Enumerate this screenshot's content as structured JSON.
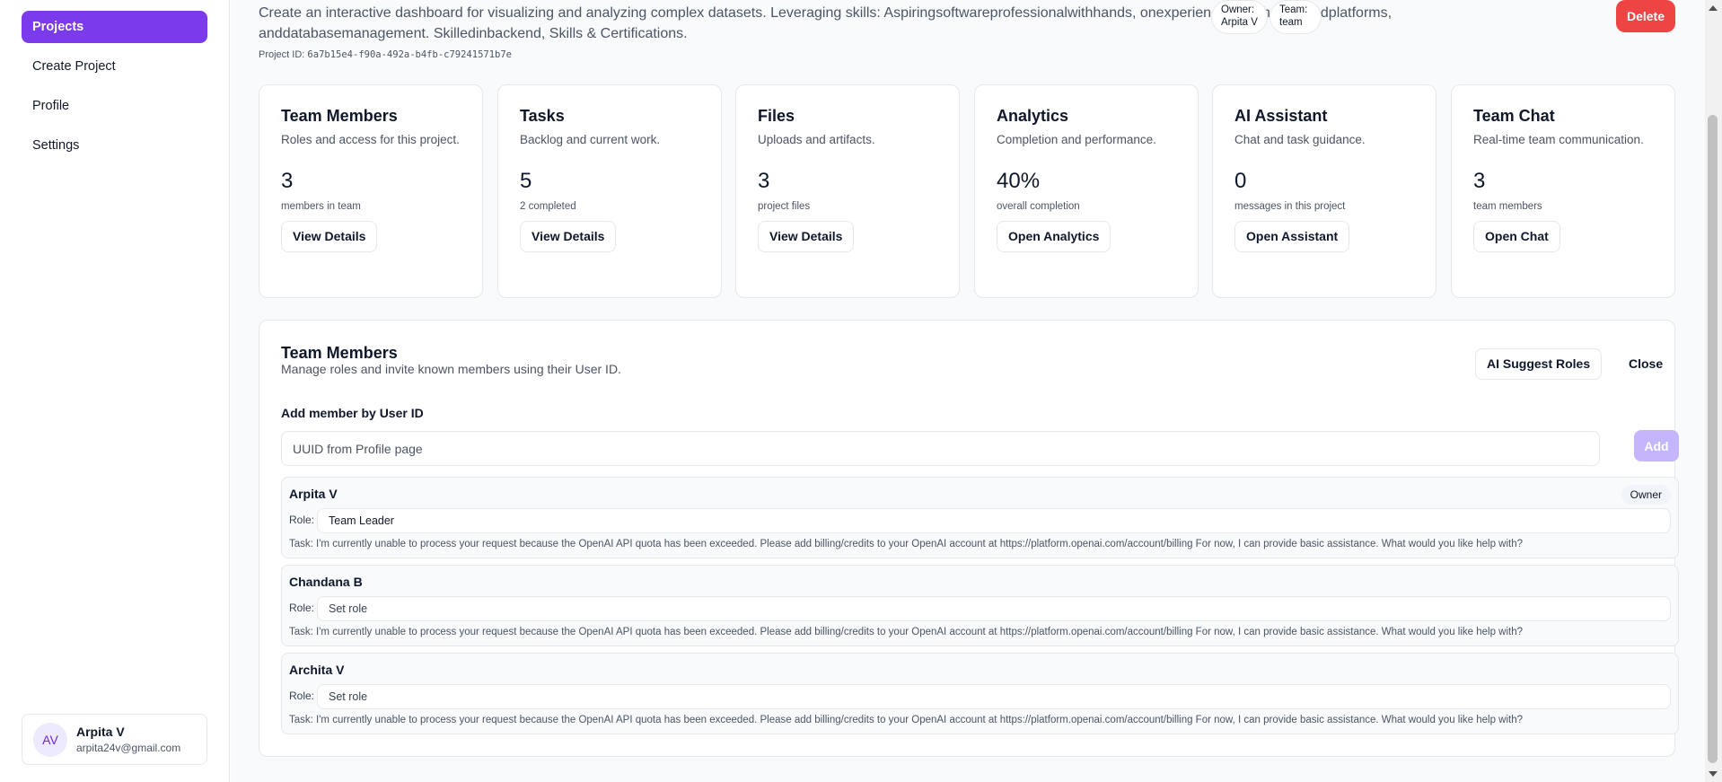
{
  "sidebar": {
    "nav": [
      {
        "label": "Projects",
        "active": true
      },
      {
        "label": "Create Project",
        "active": false
      },
      {
        "label": "Profile",
        "active": false
      },
      {
        "label": "Settings",
        "active": false
      }
    ],
    "user": {
      "initials": "AV",
      "name": "Arpita V",
      "email": "arpita24v@gmail.com"
    }
  },
  "header": {
    "description": "Create an interactive dashboard for visualizing and analyzing complex datasets. Leveraging skills: Aspiringsoftwareprofessionalwithhands, onexperiencein Python, cloudplatforms, anddatabasemanagement. Skilledinbackend, Skills & Certifications.",
    "project_id_label": "Project ID:",
    "project_id": "6a7b15e4-f90a-492a-b4fb-c79241571b7e",
    "owner_chip": {
      "line1": "Owner:",
      "line2": "Arpita V"
    },
    "team_chip": {
      "line1": "Team:",
      "line2": "team"
    },
    "delete_label": "Delete"
  },
  "cards": [
    {
      "title": "Team Members",
      "subtitle": "Roles and access for this project.",
      "value": "3",
      "caption": "members in team",
      "button": "View Details"
    },
    {
      "title": "Tasks",
      "subtitle": "Backlog and current work.",
      "value": "5",
      "caption": "2 completed",
      "button": "View Details"
    },
    {
      "title": "Files",
      "subtitle": "Uploads and artifacts.",
      "value": "3",
      "caption": "project files",
      "button": "View Details"
    },
    {
      "title": "Analytics",
      "subtitle": "Completion and performance.",
      "value": "40%",
      "caption": "overall completion",
      "button": "Open Analytics"
    },
    {
      "title": "AI Assistant",
      "subtitle": "Chat and task guidance.",
      "value": "0",
      "caption": "messages in this project",
      "button": "Open Assistant"
    },
    {
      "title": "Team Chat",
      "subtitle": "Real-time team communication.",
      "value": "3",
      "caption": "team members",
      "button": "Open Chat"
    }
  ],
  "team_panel": {
    "title": "Team Members",
    "subtitle": "Manage roles and invite known members using their User ID.",
    "ai_suggest_label": "AI Suggest Roles",
    "close_label": "Close",
    "add_label": "Add member by User ID",
    "input_placeholder": "UUID from Profile page",
    "add_button": "Add",
    "role_label": "Role:",
    "members": [
      {
        "name": "Arpita V",
        "badge": "Owner",
        "role_value": "Team Leader",
        "role_placeholder": "Set role",
        "task": "Task: I'm currently unable to process your request because the OpenAI API quota has been exceeded. Please add billing/credits to your OpenAI account at https://platform.openai.com/account/billing For now, I can provide basic assistance. What would you like help with?"
      },
      {
        "name": "Chandana B",
        "badge": "",
        "role_value": "",
        "role_placeholder": "Set role",
        "task": "Task: I'm currently unable to process your request because the OpenAI API quota has been exceeded. Please add billing/credits to your OpenAI account at https://platform.openai.com/account/billing For now, I can provide basic assistance. What would you like help with?"
      },
      {
        "name": "Archita V",
        "badge": "",
        "role_value": "",
        "role_placeholder": "Set role",
        "task": "Task: I'm currently unable to process your request because the OpenAI API quota has been exceeded. Please add billing/credits to your OpenAI account at https://platform.openai.com/account/billing For now, I can provide basic assistance. What would you like help with?"
      }
    ]
  },
  "colors": {
    "accent": "#7c3aed",
    "danger": "#ef4444",
    "add_disabled": "#c4b5fd"
  }
}
